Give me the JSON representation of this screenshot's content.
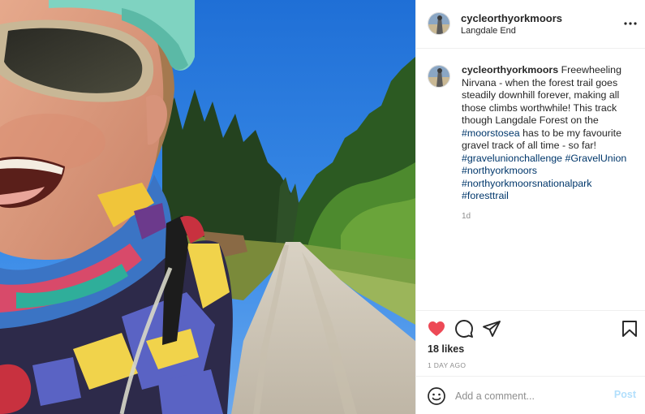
{
  "post": {
    "username": "cycleorthyorkmoors",
    "location": "Langdale End"
  },
  "caption": {
    "username": "cycleorthyorkmoors",
    "text_before_tag": " Freewheeling Nirvana - when the forest trail goes steadily downhill forever, making all those climbs worthwhile! This track though Langdale Forest on the ",
    "tag_moorstosea": "#moorstosea",
    "text_after_tag": " has to be my favourite gravel track of all time - so far!",
    "tag_gravelunionchallenge": "#gravelunionchallenge",
    "tag_gravelunion": "#GravelUnion",
    "tag_northyorkmoors": "#northyorkmoors",
    "tag_northyorkmoorsnationalpark": "#northyorkmoorsnationalpark",
    "tag_foresttrail": "#foresttrail",
    "age": "1d"
  },
  "actions": {
    "likes": "18 likes",
    "date": "1 DAY AGO"
  },
  "comment_box": {
    "placeholder": "Add a comment...",
    "post_label": "Post"
  },
  "icons": {
    "more": "more-options-icon",
    "like": "heart-icon",
    "comment": "comment-icon",
    "share": "share-icon",
    "save": "bookmark-icon",
    "emoji": "emoji-icon"
  },
  "colors": {
    "like_red": "#ed4956",
    "hashtag_blue": "#00376b",
    "post_disabled": "#b2dffc",
    "muted": "#8e8e8e"
  }
}
